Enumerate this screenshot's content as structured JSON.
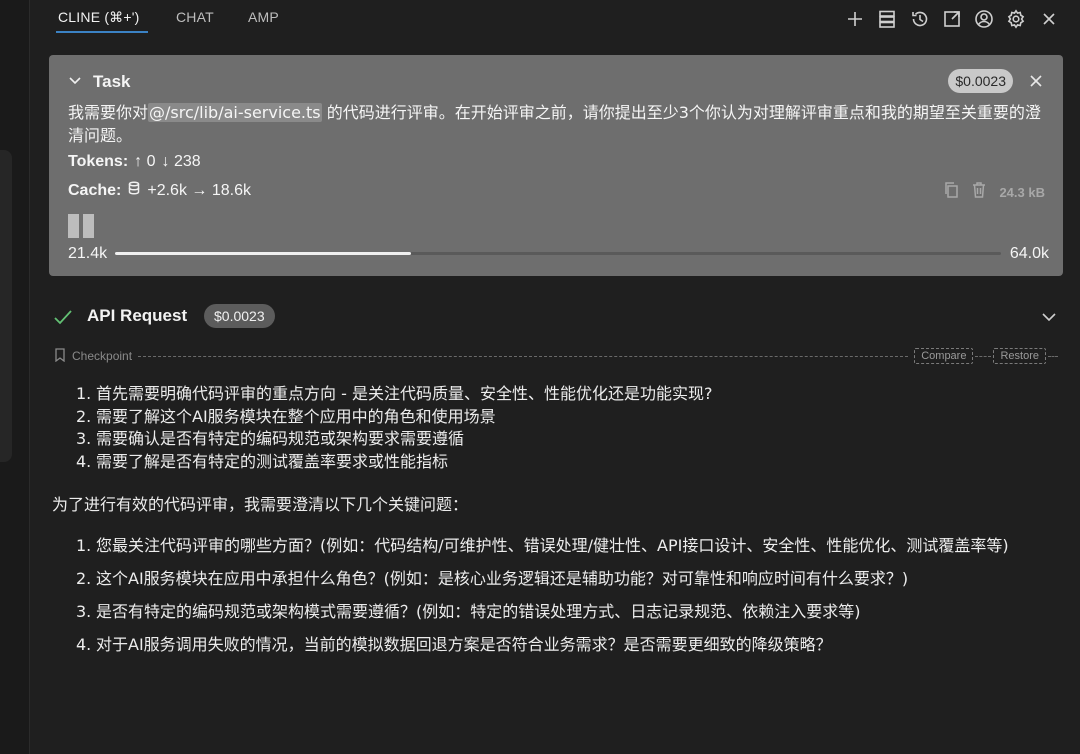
{
  "tabs": [
    {
      "label": "CLINE (⌘+')",
      "active": true
    },
    {
      "label": "CHAT",
      "active": false
    },
    {
      "label": "AMP",
      "active": false
    }
  ],
  "toolbar_icons": [
    "plus-icon",
    "server-icon",
    "history-icon",
    "external-link-icon",
    "account-icon",
    "gear-icon",
    "close-icon"
  ],
  "task": {
    "title": "Task",
    "cost": "$0.0023",
    "text_before": "我需要你对",
    "mention": "@/src/lib/ai-service.ts",
    "text_after": " 的代码进行评审。在开始评审之前，请你提出至少3个你认为对理解评审重点和我的期望至关重要的澄清问题。",
    "tokens_label": "Tokens:",
    "tokens_up": "↑ 0",
    "tokens_down": "↓ 238",
    "cache_label": "Cache:",
    "cache_value": "+2.6k → 18.6k",
    "size": "24.3 kB",
    "context_start": "21.4k",
    "context_end": "64.0k",
    "context_fraction": 0.334
  },
  "api_request": {
    "title": "API Request",
    "cost": "$0.0023"
  },
  "checkpoint": {
    "label": "Checkpoint",
    "compare": "Compare",
    "restore": "Restore"
  },
  "response": {
    "list1": [
      {
        "num": "1.",
        "text": "首先需要明确代码评审的重点方向 - 是关注代码质量、安全性、性能优化还是功能实现?"
      },
      {
        "num": "2.",
        "text": "需要了解这个AI服务模块在整个应用中的角色和使用场景"
      },
      {
        "num": "3.",
        "text": "需要确认是否有特定的编码规范或架构要求需要遵循"
      },
      {
        "num": "4.",
        "text": "需要了解是否有特定的测试覆盖率要求或性能指标"
      }
    ],
    "paragraph": "为了进行有效的代码评审，我需要澄清以下几个关键问题：",
    "list2": [
      {
        "num": "1.",
        "text": "您最关注代码评审的哪些方面？(例如：代码结构/可维护性、错误处理/健壮性、API接口设计、安全性、性能优化、测试覆盖率等)"
      },
      {
        "num": "2.",
        "text": "这个AI服务模块在应用中承担什么角色？(例如：是核心业务逻辑还是辅助功能？对可靠性和响应时间有什么要求？)"
      },
      {
        "num": "3.",
        "text": "是否有特定的编码规范或架构模式需要遵循？(例如：特定的错误处理方式、日志记录规范、依赖注入要求等)"
      },
      {
        "num": "4.",
        "text": "对于AI服务调用失败的情况，当前的模拟数据回退方案是否符合业务需求？是否需要更细致的降级策略？"
      }
    ]
  }
}
